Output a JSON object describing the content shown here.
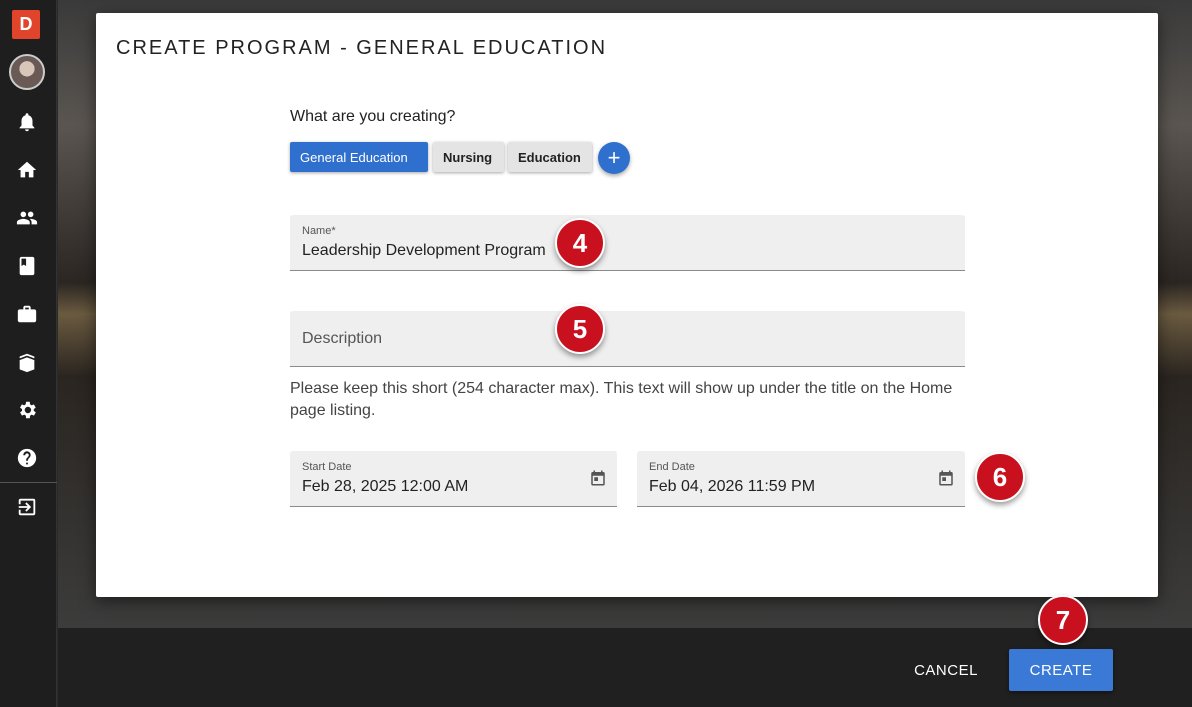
{
  "sidebar": {
    "logo_letter": "D",
    "icons": [
      "bell-icon",
      "home-icon",
      "people-icon",
      "book-icon",
      "briefcase-icon",
      "library-icon",
      "settings-icon",
      "help-icon",
      "logout-icon"
    ]
  },
  "dialog": {
    "title": "CREATE PROGRAM - GENERAL EDUCATION",
    "question": "What are you creating?",
    "types": [
      {
        "label": "General Education",
        "selected": true
      },
      {
        "label": "Nursing",
        "selected": false
      },
      {
        "label": "Education",
        "selected": false
      }
    ],
    "add_symbol": "+",
    "name_field": {
      "label": "Name*",
      "value": "Leadership Development Program"
    },
    "description_field": {
      "placeholder": "Description",
      "value": ""
    },
    "help_text": "Please keep this short (254 character max). This text will show up under the title on the Home page listing.",
    "start_date": {
      "label": "Start Date",
      "value": "Feb 28, 2025 12:00 AM"
    },
    "end_date": {
      "label": "End Date",
      "value": "Feb 04, 2026 11:59 PM"
    }
  },
  "callouts": [
    "4",
    "5",
    "6",
    "7"
  ],
  "actions": {
    "cancel_label": "CANCEL",
    "create_label": "CREATE"
  },
  "colors": {
    "accent": "#2f6fce",
    "callout": "#c8101e",
    "logo": "#e0452c"
  }
}
